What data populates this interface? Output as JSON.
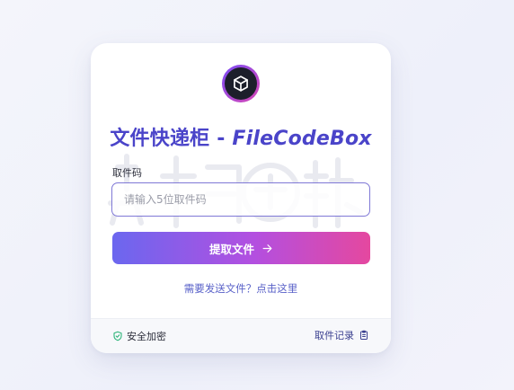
{
  "card": {
    "title_cn": "文件快递柜",
    "title_sep": " - ",
    "title_en": "FileCodeBox",
    "code_label": "取件码",
    "code_placeholder": "请输入5位取件码",
    "code_value": "",
    "submit_label": "提取文件",
    "send_link_label": "需要发送文件？点击这里"
  },
  "footer": {
    "secure_label": "安全加密",
    "records_label": "取件记录"
  },
  "colors": {
    "title": "#4a44c9",
    "gradient_start": "#6b67ef",
    "gradient_mid": "#b34fe0",
    "gradient_end": "#e5489f",
    "secure_icon": "#2fb57a",
    "link": "#5b63c9"
  },
  "icons": {
    "logo": "box-logo-icon",
    "submit": "arrow-right-icon",
    "secure": "shield-check-icon",
    "records": "clipboard-icon"
  }
}
